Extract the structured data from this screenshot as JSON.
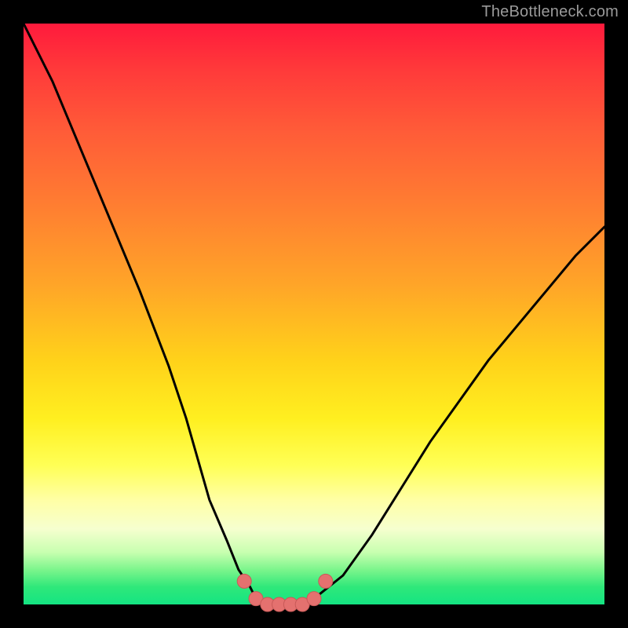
{
  "watermark": "TheBottleneck.com",
  "colors": {
    "frame": "#000000",
    "curve": "#000000",
    "markers_fill": "#e4716f",
    "markers_stroke": "#c85a58"
  },
  "chart_data": {
    "type": "line",
    "title": "",
    "xlabel": "",
    "ylabel": "",
    "xlim": [
      0,
      100
    ],
    "ylim": [
      0,
      100
    ],
    "grid": false,
    "legend": false,
    "series": [
      {
        "name": "bottleneck-curve",
        "x": [
          0,
          5,
          10,
          15,
          20,
          25,
          28,
          30,
          32,
          35,
          37,
          39,
          40,
          42,
          44,
          46,
          48,
          50,
          55,
          60,
          65,
          70,
          75,
          80,
          85,
          90,
          95,
          100
        ],
        "y": [
          100,
          90,
          78,
          66,
          54,
          41,
          32,
          25,
          18,
          11,
          6,
          3,
          1,
          0,
          0,
          0,
          0,
          1,
          5,
          12,
          20,
          28,
          35,
          42,
          48,
          54,
          60,
          65
        ]
      }
    ],
    "markers": {
      "name": "trough-markers",
      "x": [
        38,
        40,
        42,
        44,
        46,
        48,
        50,
        52
      ],
      "y": [
        4,
        1,
        0,
        0,
        0,
        0,
        1,
        4
      ]
    }
  }
}
